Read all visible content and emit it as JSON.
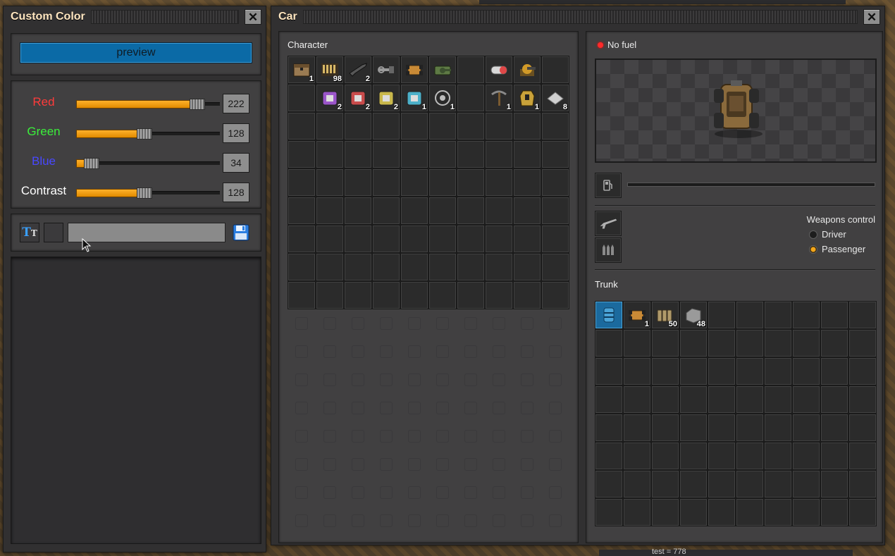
{
  "custom_color": {
    "title": "Custom Color",
    "preview_label": "preview",
    "rows": [
      {
        "label": "Red",
        "color": "#ff3b3b",
        "value": "222",
        "fraction": 0.87
      },
      {
        "label": "Green",
        "color": "#3bef3b",
        "value": "128",
        "fraction": 0.5
      },
      {
        "label": "Blue",
        "color": "#4848ff",
        "value": "34",
        "fraction": 0.13
      },
      {
        "label": "Contrast",
        "color": "#ffffff",
        "value": "128",
        "fraction": 0.5
      }
    ],
    "name_input_value": ""
  },
  "car": {
    "title": "Car",
    "character_label": "Character",
    "fuel_status": "No fuel",
    "weapons_control_label": "Weapons control",
    "weapon_options": [
      {
        "label": "Driver",
        "selected": false
      },
      {
        "label": "Passenger",
        "selected": true
      }
    ],
    "trunk_label": "Trunk",
    "character_items": [
      {
        "icon": "chest-icon",
        "count": "1",
        "color": "#9a7b52"
      },
      {
        "icon": "ammo-rack-icon",
        "count": "98",
        "color": "#d8b866"
      },
      {
        "icon": "rifle-icon",
        "count": "2",
        "color": "#575757"
      },
      {
        "icon": "grabber-icon",
        "count": "",
        "color": "#9a9a9a"
      },
      {
        "icon": "car-icon",
        "count": "",
        "color": "#c98a36"
      },
      {
        "icon": "tank-icon",
        "count": "",
        "color": "#5e7a45"
      },
      {
        "icon": "",
        "count": "",
        "color": ""
      },
      {
        "icon": "capsule-icon",
        "count": "",
        "color": "#d8d8d8"
      },
      {
        "icon": "turret-icon",
        "count": "",
        "color": "#d19a28"
      },
      {
        "icon": "",
        "count": "",
        "color": ""
      },
      {
        "icon": "",
        "count": "",
        "color": ""
      },
      {
        "icon": "purple-module-icon",
        "count": "2",
        "color": "#9a55c9"
      },
      {
        "icon": "red-module-icon",
        "count": "2",
        "color": "#c94c4c"
      },
      {
        "icon": "yellow-module-icon",
        "count": "2",
        "color": "#c9b84c"
      },
      {
        "icon": "cyan-module-icon",
        "count": "1",
        "color": "#4cb0c9"
      },
      {
        "icon": "clock-icon",
        "count": "1",
        "color": "#bdbdbd"
      },
      {
        "icon": "",
        "count": "",
        "color": ""
      },
      {
        "icon": "pickaxe-icon",
        "count": "1",
        "color": "#8a8a8a"
      },
      {
        "icon": "armor-icon",
        "count": "1",
        "color": "#c9a23a"
      },
      {
        "icon": "plate-icon",
        "count": "8",
        "color": "#cfcfcf"
      }
    ],
    "trunk_items": [
      {
        "icon": "barrel-icon",
        "count": "",
        "color": "#4aa4d8"
      },
      {
        "icon": "car-icon",
        "count": "1",
        "color": "#c98a36"
      },
      {
        "icon": "magazine-icon",
        "count": "50",
        "color": "#b09a6a"
      },
      {
        "icon": "stone-icon",
        "count": "48",
        "color": "#9a9a9a"
      }
    ]
  },
  "background": {
    "bottom_text": "test = 778"
  }
}
